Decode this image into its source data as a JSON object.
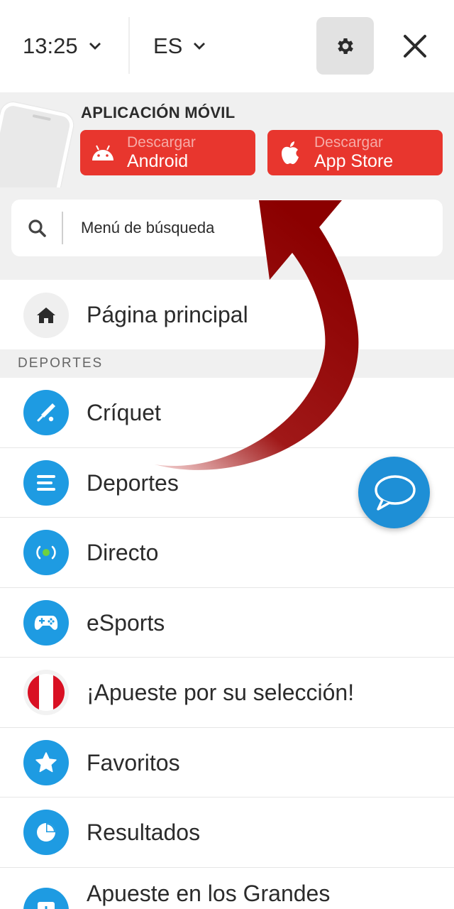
{
  "topbar": {
    "time": "13:25",
    "language": "ES",
    "settings_icon": "gear-icon",
    "close_icon": "close-icon"
  },
  "app_banner": {
    "title": "APLICACIÓN MÓVIL",
    "android": {
      "small": "Descargar",
      "big": "Android",
      "icon": "android-icon"
    },
    "apple": {
      "small": "Descargar",
      "big": "App Store",
      "icon": "apple-icon"
    }
  },
  "search": {
    "placeholder": "Menú de búsqueda",
    "icon": "search-icon"
  },
  "home": {
    "label": "Página principal",
    "icon": "home-icon"
  },
  "section": {
    "title": "DEPORTES"
  },
  "menu": [
    {
      "label": "Críquet",
      "icon": "cricket-icon"
    },
    {
      "label": "Deportes",
      "icon": "list-icon"
    },
    {
      "label": "Directo",
      "icon": "live-icon"
    },
    {
      "label": "eSports",
      "icon": "gamepad-icon"
    },
    {
      "label": "¡Apueste por su selección!",
      "icon": "peru-flag-icon"
    },
    {
      "label": "Favoritos",
      "icon": "star-icon"
    },
    {
      "label": "Resultados",
      "icon": "pie-chart-icon"
    },
    {
      "label": "Apueste en los Grandes",
      "icon": "bar-chart-icon"
    }
  ],
  "chat": {
    "icon": "chat-icon"
  },
  "colors": {
    "accent_red": "#e8362e",
    "accent_blue": "#1e9be2",
    "arrow": "#8b0000"
  }
}
